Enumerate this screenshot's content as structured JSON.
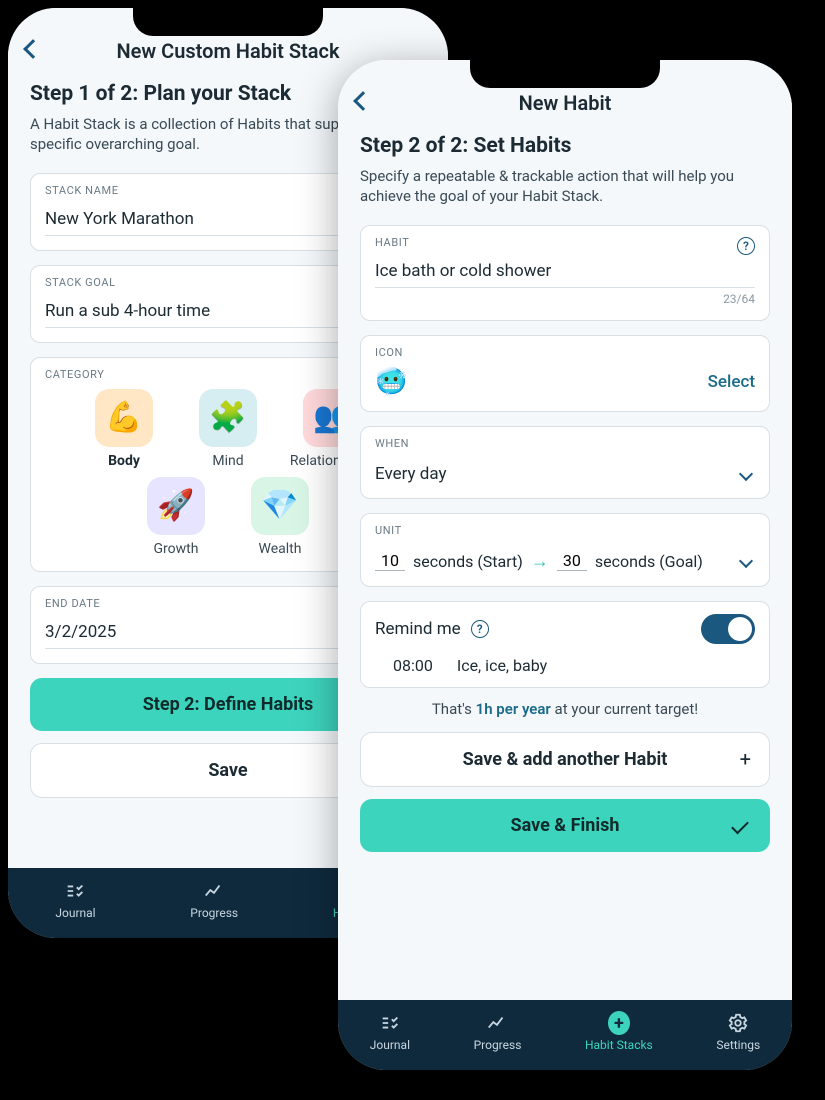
{
  "left": {
    "header_title": "New Custom Habit Stack",
    "step_title": "Step 1 of 2: Plan your Stack",
    "step_desc": "A Habit Stack is a collection of Habits that support a specific overarching goal.",
    "stack_name_label": "STACK NAME",
    "stack_name_value": "New York Marathon",
    "stack_goal_label": "STACK GOAL",
    "stack_goal_value": "Run a sub 4-hour time",
    "category_label": "CATEGORY",
    "categories": [
      {
        "label": "Body",
        "emoji": "💪",
        "bg": "#ffe6c4",
        "selected": true
      },
      {
        "label": "Mind",
        "emoji": "🧩",
        "bg": "#d6eef2",
        "selected": false
      },
      {
        "label": "Relationships",
        "emoji": "👥",
        "bg": "#ffd9db",
        "selected": false
      },
      {
        "label": "Growth",
        "emoji": "🚀",
        "bg": "#e7e4ff",
        "selected": false
      },
      {
        "label": "Wealth",
        "emoji": "💎",
        "bg": "#d8f5e6",
        "selected": false
      }
    ],
    "end_date_label": "END DATE",
    "end_date_value": "3/2/2025",
    "primary_btn": "Step 2: Define Habits",
    "secondary_btn": "Save"
  },
  "right": {
    "header_title": "New Habit",
    "step_title": "Step 2 of 2: Set Habits",
    "step_desc": "Specify a repeatable & trackable action that will help you achieve the goal of your Habit Stack.",
    "habit_label": "HABIT",
    "habit_value": "Ice bath or cold shower",
    "habit_count": "23/64",
    "icon_label": "ICON",
    "icon_emoji": "🥶",
    "icon_select": "Select",
    "when_label": "WHEN",
    "when_value": "Every day",
    "unit_label": "UNIT",
    "unit_start_num": "10",
    "unit_start_text": "seconds (Start)",
    "unit_goal_num": "30",
    "unit_goal_text": "seconds (Goal)",
    "remind_label": "Remind me",
    "remind_time": "08:00",
    "remind_msg": "Ice, ice, baby",
    "summary_prefix": "That's ",
    "summary_highlight": "1h per year",
    "summary_suffix": " at your current target!",
    "add_btn": "Save & add another Habit",
    "finish_btn": "Save & Finish"
  },
  "nav": {
    "items": [
      {
        "label": "Journal",
        "active": false
      },
      {
        "label": "Progress",
        "active": false
      },
      {
        "label": "Habit Stacks",
        "active": true
      },
      {
        "label": "Settings",
        "active": false
      }
    ]
  }
}
